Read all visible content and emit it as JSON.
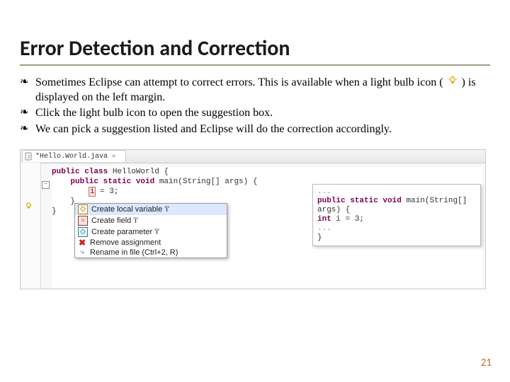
{
  "title": "Error Detection and Correction",
  "bullets": {
    "b1a": "Sometimes Eclipse can attempt to correct errors.  This is available when a light bulb icon (",
    "b1b": ") is displayed on the left margin.",
    "b2": "Click the light bulb icon to open the suggestion box.",
    "b3": "We can pick a suggestion listed and Eclipse will do the correction accordingly."
  },
  "tab": {
    "filename": "*Hello.World.java",
    "close": "✕"
  },
  "code": {
    "l1_kw": "public class",
    "l1_rest": " HelloWorld {",
    "l2_kw1": "    public static void",
    "l2_mid": " main(String[] args) {",
    "l3_err": "i",
    "l3_rest": " = 3;",
    "l4": "    }",
    "l5": "}",
    "fold": "−"
  },
  "suggestions": {
    "s1": "Create local variable 'i'",
    "s2": "Create field 'i'",
    "s3": "Create parameter 'i'",
    "s4": "Remove assignment",
    "s5": "Rename in file (Ctrl+2, R)"
  },
  "preview": {
    "p0": "...",
    "p1": "public static void main(String[] args) {",
    "p2": "int i = 3;",
    "p3": "...",
    "p4": "}"
  },
  "page": "21"
}
